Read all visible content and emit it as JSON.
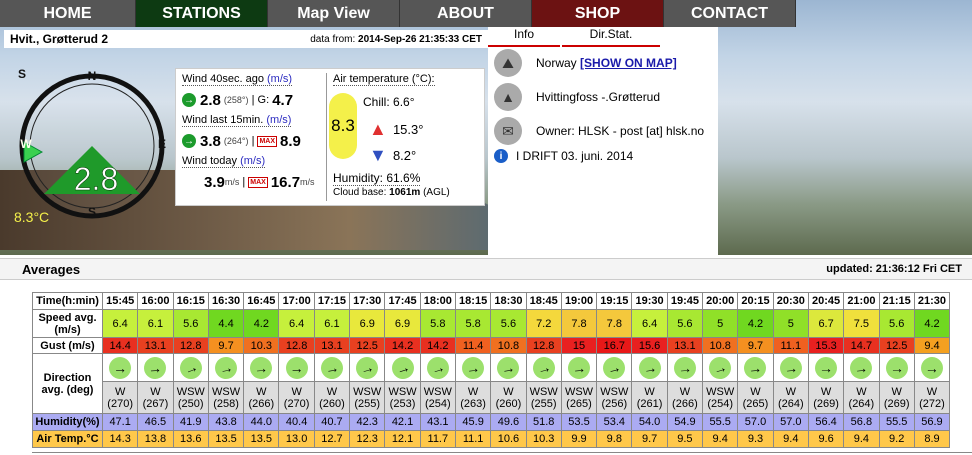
{
  "nav": [
    "HOME",
    "STATIONS",
    "Map View",
    "ABOUT",
    "SHOP",
    "CONTACT"
  ],
  "station": {
    "name": "Hvit., Grøtterud 2",
    "data_from_label": "data from:",
    "data_from": "2014-Sep-26 21:35:33 CET"
  },
  "compass": {
    "n": "N",
    "s": "S",
    "e": "E",
    "w": "W",
    "s_top": "S",
    "speed": "2.8",
    "temp": "8.3°C"
  },
  "wind": {
    "w40_label": "Wind 40sec. ago",
    "w40_unit": "(m/s)",
    "w40_val": "2.8",
    "w40_dir": "(258°)",
    "g_label": "| G:",
    "g_val": "4.7",
    "w15_label": "Wind last 15min.",
    "w15_unit": "(m/s)",
    "w15_val": "3.8",
    "w15_dir": "(264°)",
    "w15_max": "8.9",
    "wt_label": "Wind today",
    "wt_unit": "(m/s)",
    "wt_avg": "3.9",
    "wt_avg_u": "m/s",
    "wt_max": "16.7",
    "wt_max_u": "m/s",
    "max_label": "MAX"
  },
  "air": {
    "label": "Air temperature (°C):",
    "temp": "8.3",
    "chill_label": "Chill:",
    "chill": "6.6°",
    "hi": "15.3°",
    "lo": "8.2°",
    "humidity": "Humidity: 61.6%",
    "cloud_label": "Cloud base:",
    "cloud_val": "1061m",
    "cloud_unit": "(AGL)"
  },
  "info": {
    "tab1": "Info",
    "tab2": "Dir.Stat.",
    "country": "Norway",
    "map_link": "[SHOW ON MAP]",
    "place": "Hvittingfoss -.Grøtterud",
    "owner": "Owner: HLSK - post [at] hlsk.no",
    "drift": "I DRIFT 03. juni. 2014"
  },
  "averages": {
    "title": "Averages",
    "updated": "updated: 21:36:12 Fri CET"
  },
  "table": {
    "labels": {
      "time": "Time(h:min)",
      "speed": "Speed avg. (m/s)",
      "gust": "Gust (m/s)",
      "direction": "Direction avg. (deg)",
      "humidity": "Humidity(%)",
      "air": "Air Temp.°C"
    },
    "times": [
      "15:45",
      "16:00",
      "16:15",
      "16:30",
      "16:45",
      "17:00",
      "17:15",
      "17:30",
      "17:45",
      "18:00",
      "18:15",
      "18:30",
      "18:45",
      "19:00",
      "19:15",
      "19:30",
      "19:45",
      "20:00",
      "20:15",
      "20:30",
      "20:45",
      "21:00",
      "21:15",
      "21:30"
    ],
    "speed": [
      "6.4",
      "6.1",
      "5.6",
      "4.4",
      "4.2",
      "6.4",
      "6.1",
      "6.9",
      "6.9",
      "5.8",
      "5.8",
      "5.6",
      "7.2",
      "7.8",
      "7.8",
      "6.4",
      "5.6",
      "5",
      "4.2",
      "5",
      "6.7",
      "7.5",
      "5.6",
      "4.2"
    ],
    "speed_colors": [
      "#c6f03c",
      "#c6f03c",
      "#a8e832",
      "#70d820",
      "#70d820",
      "#c6f03c",
      "#c6f03c",
      "#e8e83c",
      "#e8e83c",
      "#a8e832",
      "#a8e832",
      "#a8e832",
      "#f4d83c",
      "#f4c83c",
      "#f4c83c",
      "#c6f03c",
      "#a8e832",
      "#90e028",
      "#70d820",
      "#90e028",
      "#dce83c",
      "#f0e03c",
      "#a8e832",
      "#70d820"
    ],
    "gust": [
      "14.4",
      "13.1",
      "12.8",
      "9.7",
      "10.3",
      "12.8",
      "13.1",
      "12.5",
      "14.2",
      "14.2",
      "11.4",
      "10.8",
      "12.8",
      "15",
      "16.7",
      "15.6",
      "13.1",
      "10.8",
      "9.7",
      "11.1",
      "15.3",
      "14.7",
      "12.5",
      "9.4"
    ],
    "gust_colors": [
      "#e83020",
      "#e84020",
      "#e84020",
      "#f49020",
      "#f07020",
      "#e84020",
      "#e84020",
      "#e84020",
      "#e83020",
      "#e83020",
      "#f06020",
      "#f07020",
      "#e84020",
      "#e82020",
      "#e81818",
      "#e82020",
      "#e84020",
      "#f07020",
      "#f49020",
      "#f06020",
      "#e82020",
      "#e83020",
      "#e84020",
      "#f4a020"
    ],
    "dir_names": [
      "W",
      "W",
      "WSW",
      "WSW",
      "W",
      "W",
      "W",
      "WSW",
      "WSW",
      "WSW",
      "W",
      "W",
      "WSW",
      "WSW",
      "WSW",
      "W",
      "W",
      "WSW",
      "W",
      "W",
      "W",
      "W",
      "W",
      "W"
    ],
    "dir_degs": [
      "(270)",
      "(267)",
      "(250)",
      "(258)",
      "(266)",
      "(270)",
      "(260)",
      "(255)",
      "(253)",
      "(254)",
      "(263)",
      "(260)",
      "(255)",
      "(265)",
      "(256)",
      "(261)",
      "(266)",
      "(254)",
      "(265)",
      "(264)",
      "(269)",
      "(264)",
      "(269)",
      "(272)"
    ],
    "humidity": [
      "47.1",
      "46.5",
      "41.9",
      "43.8",
      "44.0",
      "40.4",
      "40.7",
      "42.3",
      "42.1",
      "43.1",
      "45.9",
      "49.6",
      "51.8",
      "53.5",
      "53.4",
      "54.0",
      "54.9",
      "55.5",
      "57.0",
      "57.0",
      "56.4",
      "56.8",
      "55.5",
      "56.9"
    ],
    "air": [
      "14.3",
      "13.8",
      "13.6",
      "13.5",
      "13.5",
      "13.0",
      "12.7",
      "12.3",
      "12.1",
      "11.7",
      "11.1",
      "10.6",
      "10.3",
      "9.9",
      "9.8",
      "9.7",
      "9.5",
      "9.4",
      "9.3",
      "9.4",
      "9.6",
      "9.4",
      "9.2",
      "8.9"
    ]
  }
}
